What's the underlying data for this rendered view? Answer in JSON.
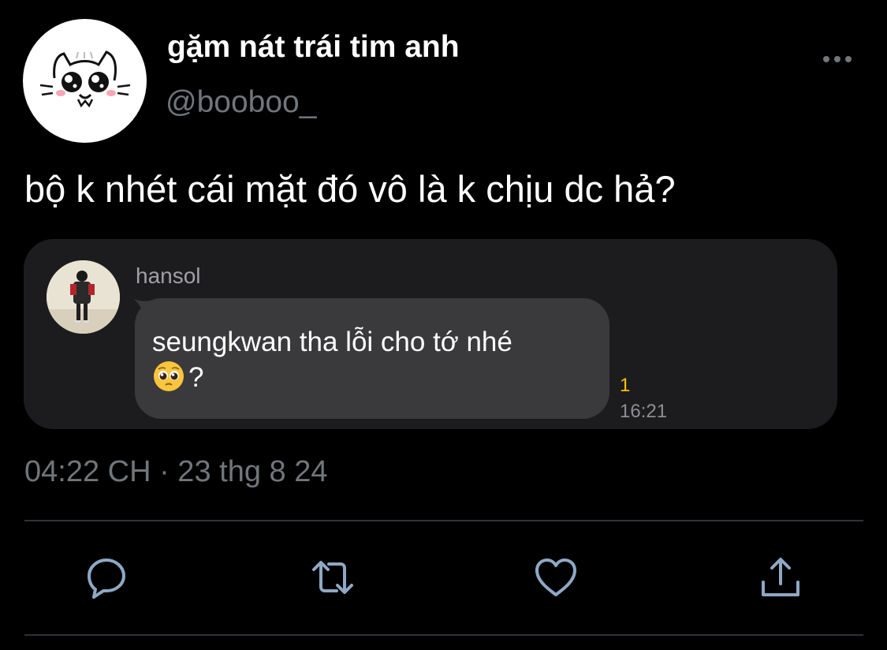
{
  "author": {
    "display_name": "gặm nát trái tim anh",
    "handle": "@booboo_",
    "avatar_icon": "cartoon-cat-icon"
  },
  "tweet": {
    "text": "bộ k nhét cái mặt đó vô là k chịu dc hả?",
    "timestamp": "04:22 CH · 23 thg 8 24"
  },
  "quoted_message": {
    "sender": "hansol",
    "message_text": "seungkwan tha lỗi cho tớ nhé",
    "message_suffix": "?",
    "emoji": "pleading-face-emoji",
    "unread_count": "1",
    "time": "16:21"
  },
  "actions": [
    "reply-icon",
    "retweet-icon",
    "like-icon",
    "share-icon"
  ],
  "colors": {
    "background": "#000000",
    "muted_text": "#71767b",
    "card": "#1c1c1e",
    "bubble": "#3a3a3c",
    "unread": "#f5c400",
    "icon_blue": "#8ea8c4"
  }
}
